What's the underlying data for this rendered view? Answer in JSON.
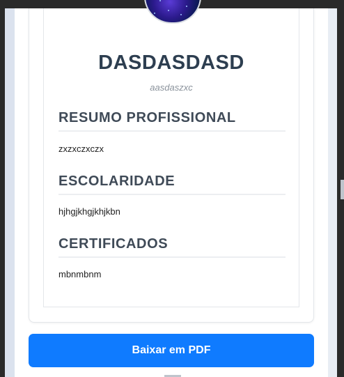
{
  "profile": {
    "name": "DASDASDASD",
    "subtitle": "aasdaszxc"
  },
  "sections": [
    {
      "title": "RESUMO PROFISSIONAL",
      "text": "zxzxczxczx"
    },
    {
      "title": "ESCOLARIDADE",
      "text": "hjhgjkhgjkhjkbn"
    },
    {
      "title": "CERTIFICADOS",
      "text": "mbnmbnm"
    }
  ],
  "actions": {
    "download_pdf_label": "Baixar em PDF"
  },
  "colors": {
    "accent": "#0f7bff",
    "heading": "#2d3e50",
    "section_heading": "#3f4a57",
    "muted": "#8a929b"
  }
}
